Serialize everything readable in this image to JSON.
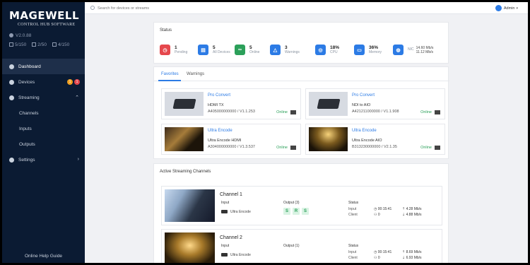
{
  "sidebar": {
    "logo": "MAGEWELL",
    "logo_sub": "CONTROL HUB SOFTWARE",
    "version": "V2.0.88",
    "counts": [
      "5/150",
      "2/50",
      "4/150"
    ],
    "items": [
      {
        "label": "Dashboard"
      },
      {
        "label": "Devices",
        "badge1": "1",
        "badge2": "1"
      },
      {
        "label": "Streaming"
      },
      {
        "label": "Channels"
      },
      {
        "label": "Inputs"
      },
      {
        "label": "Outputs"
      },
      {
        "label": "Settings"
      }
    ],
    "help": "Online Help Guide"
  },
  "topbar": {
    "search_placeholder": "Search for devices or streams",
    "user": "Admin"
  },
  "status": {
    "title": "Status",
    "items": [
      {
        "num": "1",
        "label": "Pending",
        "color": "#e5484d",
        "icon": "clock-icon"
      },
      {
        "num": "5",
        "label": "All Devices",
        "color": "#2c7be5",
        "icon": "device-icon"
      },
      {
        "num": "5",
        "label": "Online",
        "color": "#2ca05a",
        "icon": "link-icon"
      },
      {
        "num": "3",
        "label": "Warnings",
        "color": "#2c7be5",
        "icon": "warning-icon"
      },
      {
        "num": "18%",
        "label": "CPU",
        "color": "#2c7be5",
        "icon": "cpu-icon"
      },
      {
        "num": "36%",
        "label": "Memory",
        "color": "#2c7be5",
        "icon": "memory-icon"
      },
      {
        "up": "14.60 Mb/s",
        "down": "11.12 Mb/s",
        "label": "NIC",
        "color": "#2c7be5",
        "icon": "network-icon"
      }
    ]
  },
  "tabs": {
    "favorites": "Favorites",
    "warnings": "Warnings"
  },
  "favorites": [
    {
      "name": "Pro Convert",
      "model": "HDMI TX",
      "sn": "A405000000000 / V1.1.253",
      "status": "Online"
    },
    {
      "name": "Pro Convert",
      "model": "NDI to AIO",
      "sn": "A421211000000 / V1.1.908",
      "status": "Online"
    },
    {
      "name": "Ultra Encode",
      "model": "Ultra Encode HDMI",
      "sn": "A304000000000 / V1.3.537",
      "status": "Online"
    },
    {
      "name": "Ultra Encode",
      "model": "Ultra Encode AIO",
      "sn": "B313230000000 / V2.1.35",
      "status": "Online"
    }
  ],
  "streaming": {
    "title": "Active Streaming Channels",
    "channels": [
      {
        "name": "Channel 1",
        "input_label": "Input",
        "input": "Ultra Encode",
        "output_label": "Output (3)",
        "outputs": [
          "S",
          "R",
          "S"
        ],
        "status_label": "Status",
        "input_k": "Input",
        "client_k": "Client",
        "time": "00:15:41",
        "clients": "0",
        "up": "4.28 Mb/s",
        "down": "4.88 Mb/s"
      },
      {
        "name": "Channel 2",
        "input_label": "Input",
        "input": "Ultra Encode",
        "output_label": "Output (1)",
        "outputs": [],
        "status_label": "Status",
        "input_k": "Input",
        "client_k": "Client",
        "time": "00:15:41",
        "clients": "0",
        "up": "8.69 Mb/s",
        "down": "6.93 Mb/s"
      }
    ]
  }
}
